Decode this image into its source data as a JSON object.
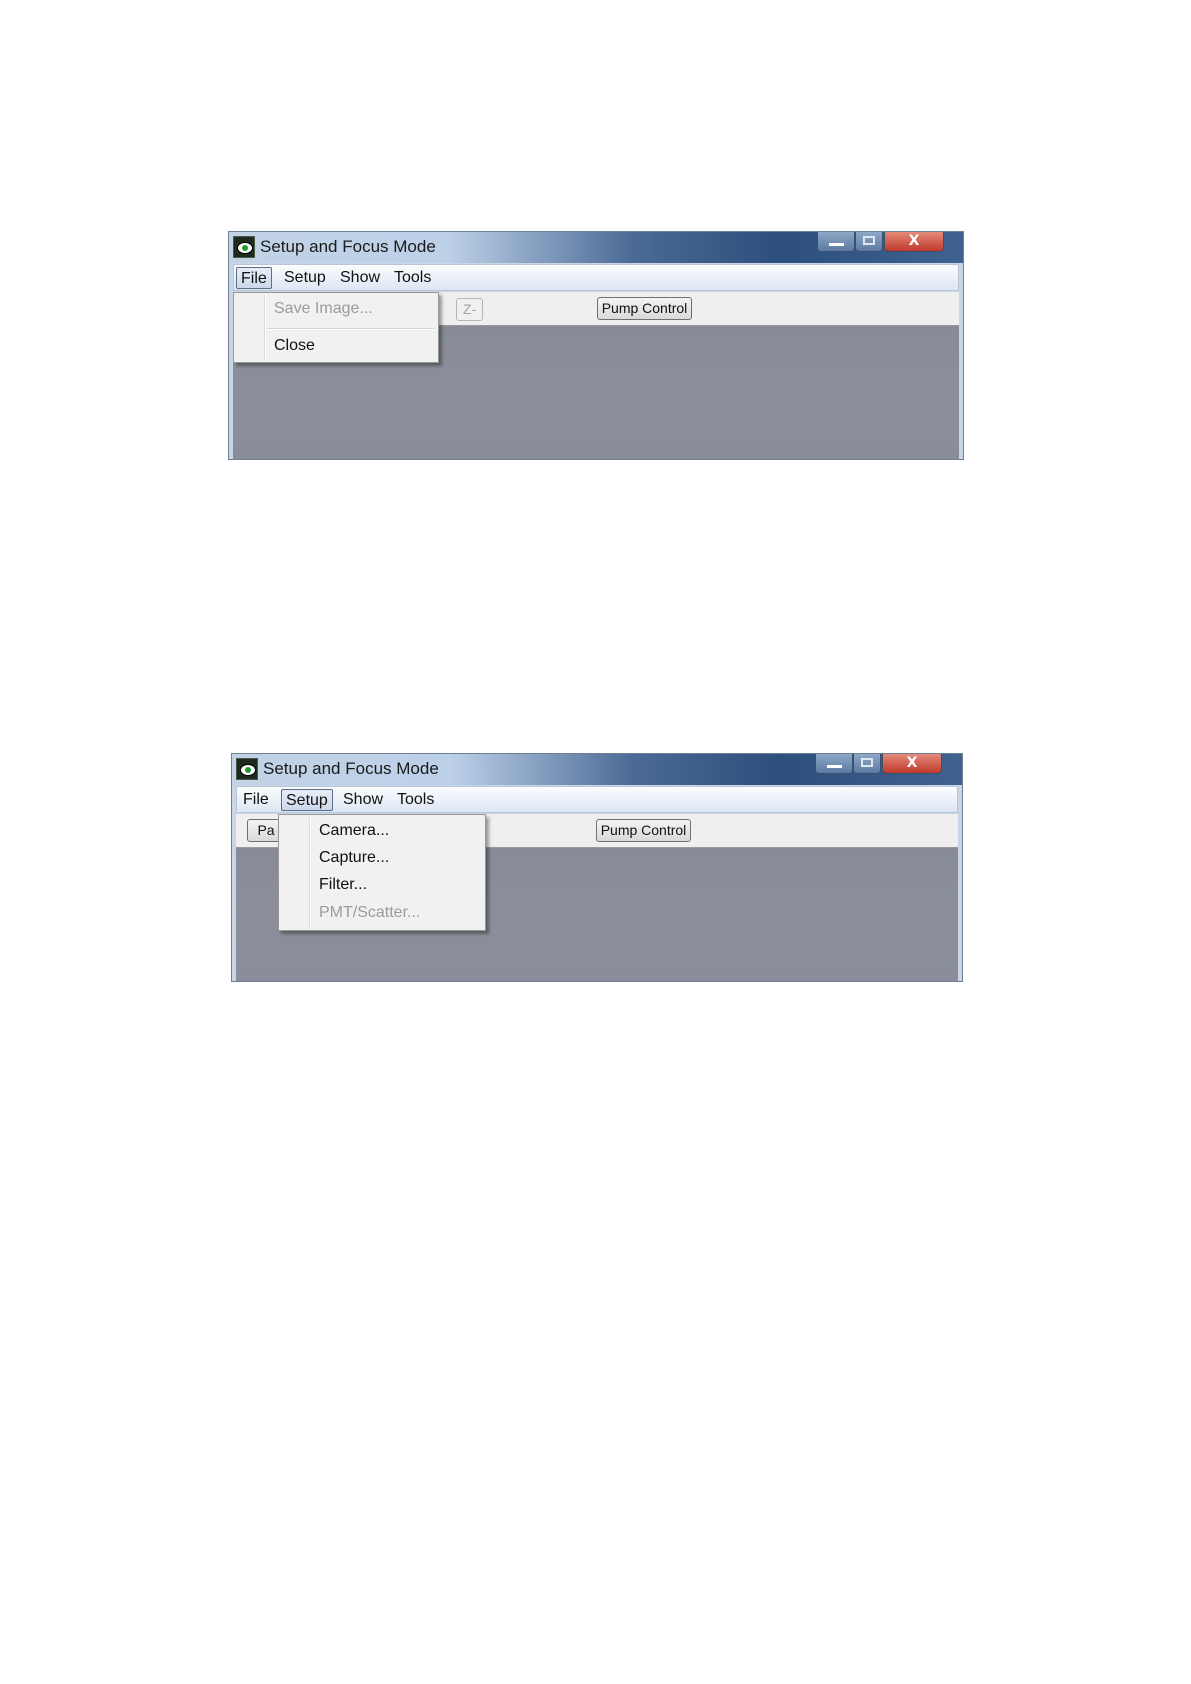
{
  "screenshots": [
    {
      "window": {
        "title": "Setup and Focus Mode",
        "close_glyph": "X"
      },
      "menu": [
        "File",
        "Setup",
        "Show",
        "Tools"
      ],
      "active_menu": "File",
      "toolbar": {
        "zminus_label": "Z-",
        "pump_label": "Pump Control"
      },
      "dropdown": [
        {
          "label": "Save Image...",
          "disabled": true
        },
        {
          "label": "Close",
          "disabled": false
        }
      ]
    },
    {
      "window": {
        "title": "Setup and Focus Mode",
        "close_glyph": "X"
      },
      "menu": [
        "File",
        "Setup",
        "Show",
        "Tools"
      ],
      "active_menu": "Setup",
      "toolbar": {
        "partial_button_label": "Pa",
        "pump_label": "Pump Control"
      },
      "dropdown": [
        {
          "label": "Camera...",
          "disabled": false
        },
        {
          "label": "Capture...",
          "disabled": false
        },
        {
          "label": "Filter...",
          "disabled": false
        },
        {
          "label": "PMT/Scatter...",
          "disabled": true
        }
      ]
    }
  ],
  "icons": {
    "app": "eye-icon",
    "minimize": "minimize-icon",
    "maximize": "maximize-icon",
    "close": "close-icon"
  },
  "colors": {
    "content_bg": "#8a8d99",
    "close_button": "#c0392b",
    "title_gradient_dark": "#2d4f7d"
  }
}
